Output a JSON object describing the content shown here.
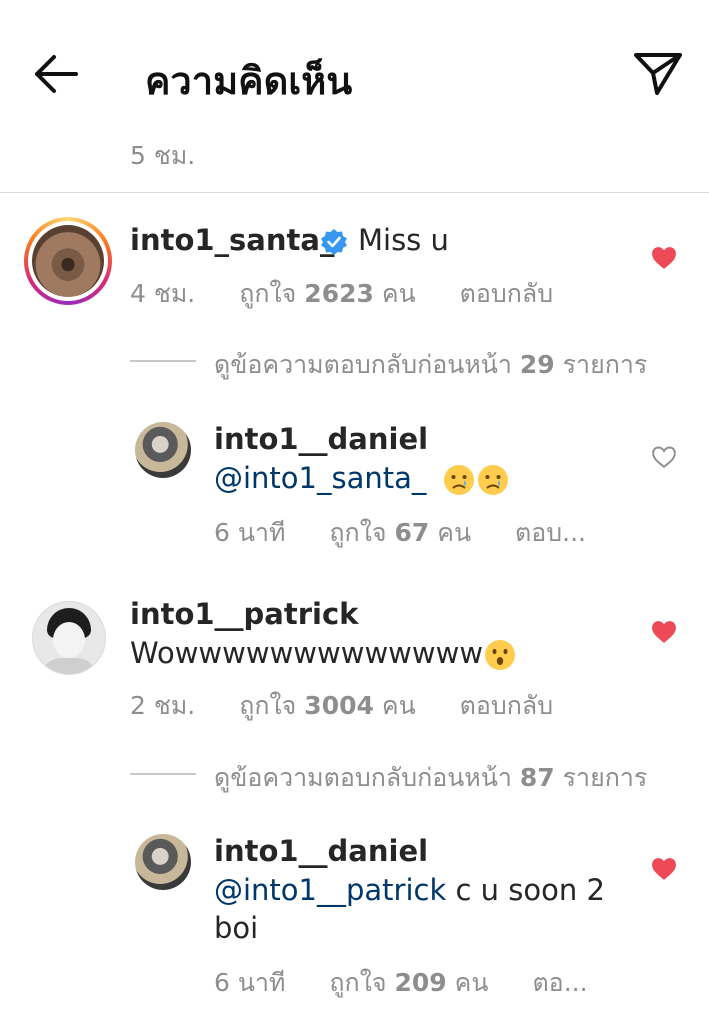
{
  "header": {
    "title": "ความคิดเห็น"
  },
  "top_meta": {
    "time": "5 ชม."
  },
  "comments": [
    {
      "username": "into1_santa_",
      "text": "Miss u",
      "time": "4 ชม.",
      "likes_prefix": "ถูกใจ",
      "likes_count": "2623",
      "likes_suffix": "คน",
      "reply": "ตอบกลับ",
      "view_replies_prefix": "ดูข้อความตอบกลับก่อนหน้า",
      "view_replies_count": "29",
      "view_replies_suffix": "รายการ",
      "liked": true
    },
    {
      "username": "into1__daniel",
      "mention": "@into1_santa_",
      "time": "6 นาที",
      "likes_prefix": "ถูกใจ",
      "likes_count": "67",
      "likes_suffix": "คน",
      "reply": "ตอบ...",
      "liked": false
    },
    {
      "username": "into1__patrick",
      "text": "Wowwwwwwwwwwwww",
      "time": "2 ชม.",
      "likes_prefix": "ถูกใจ",
      "likes_count": "3004",
      "likes_suffix": "คน",
      "reply": "ตอบกลับ",
      "view_replies_prefix": "ดูข้อความตอบกลับก่อนหน้า",
      "view_replies_count": "87",
      "view_replies_suffix": "รายการ",
      "liked": true
    },
    {
      "username": "into1__daniel",
      "mention": "@into1__patrick",
      "text": "c u soon 2",
      "text_line2": "boi",
      "time": "6 นาที",
      "likes_prefix": "ถูกใจ",
      "likes_count": "209",
      "likes_suffix": "คน",
      "reply": "ตอ...",
      "liked": true
    }
  ],
  "icons": {
    "back": "arrow-left-icon",
    "send": "paper-plane-icon",
    "verified": "verified-badge-icon",
    "heart_filled": "heart-filled-icon",
    "heart_outline": "heart-outline-icon",
    "emoji_cry": "crying-face-emoji",
    "emoji_hushed": "hushed-face-emoji"
  },
  "colors": {
    "heart": "#ed4956",
    "mention": "#00376b",
    "verified": "#3897f0",
    "meta": "#8e8e8e"
  }
}
